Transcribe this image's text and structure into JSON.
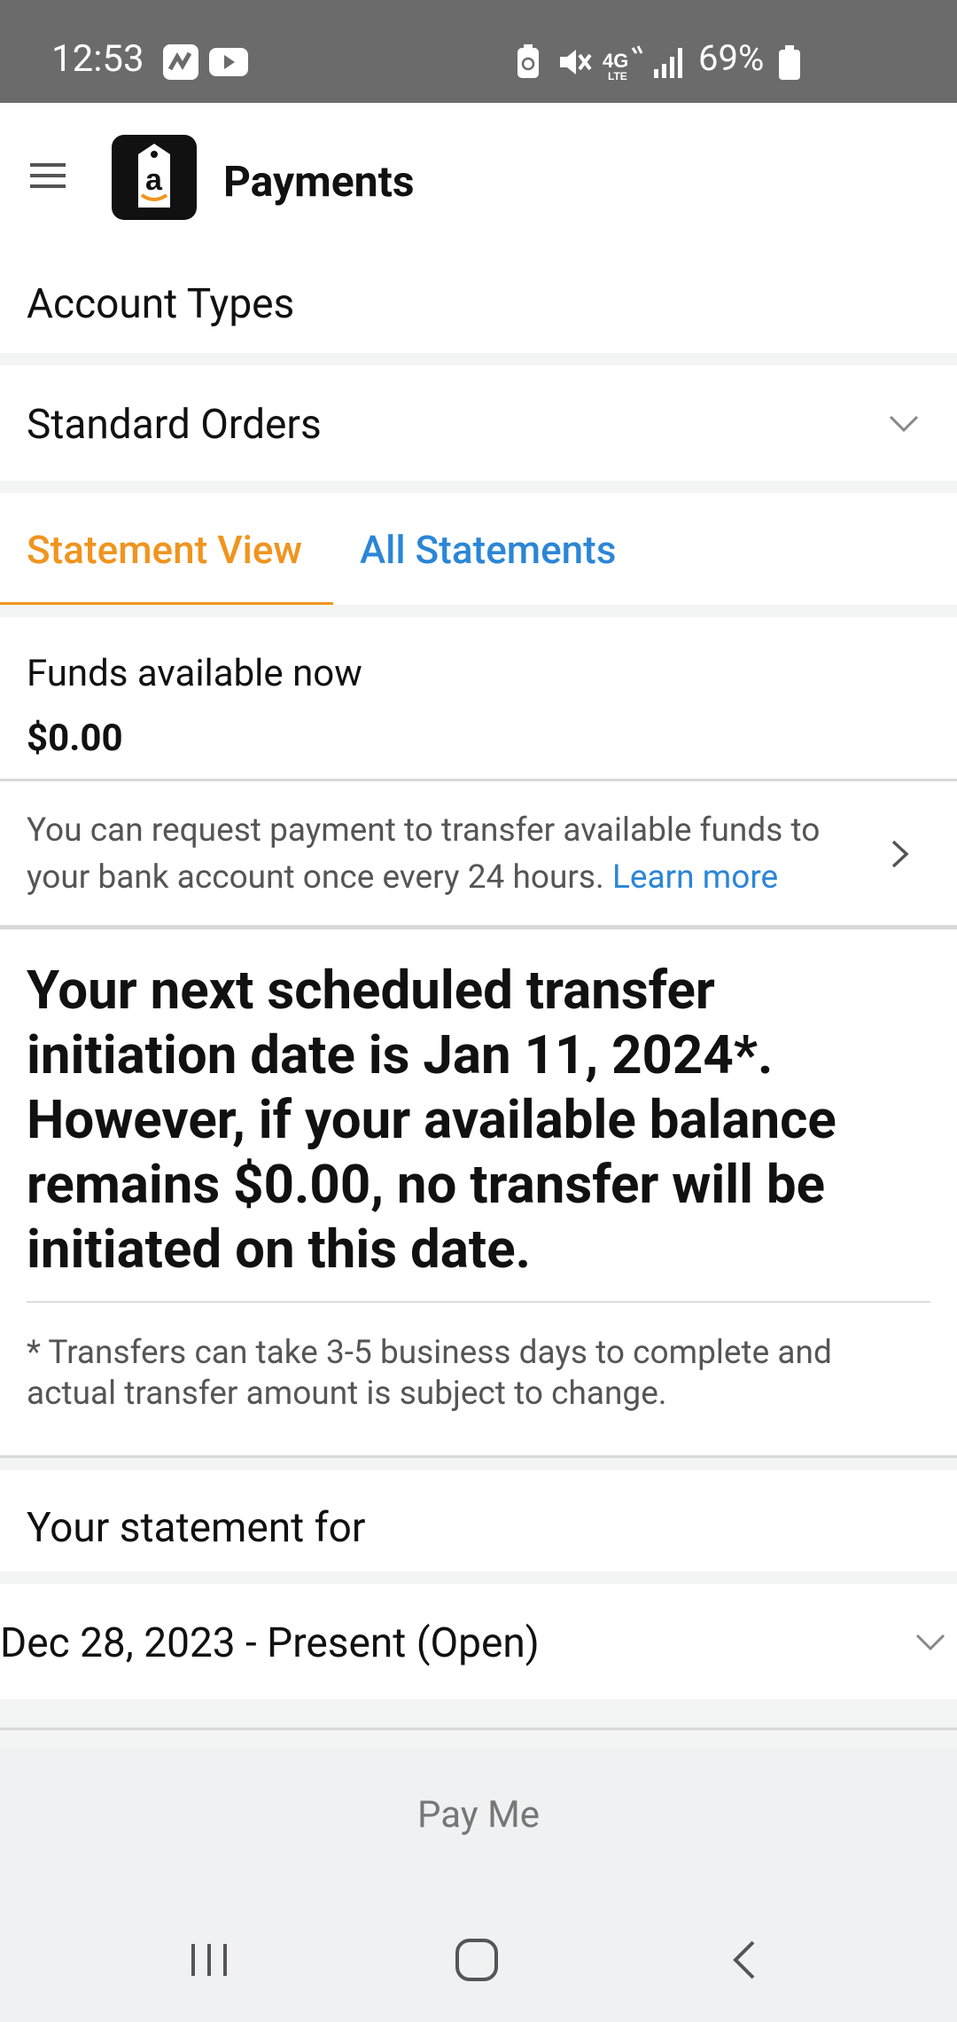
{
  "status_bar": {
    "time": "12:53",
    "battery_percent": "69%"
  },
  "app_bar": {
    "title": "Payments",
    "logo_letter": "a"
  },
  "account_types": {
    "heading": "Account Types",
    "selected": "Standard Orders"
  },
  "tabs": [
    {
      "label": "Statement View",
      "active": true
    },
    {
      "label": "All Statements",
      "active": false
    }
  ],
  "funds": {
    "label": "Funds available now",
    "value": "$0.00"
  },
  "info": {
    "text": "You can request payment to transfer available funds to your bank account once every 24 hours.",
    "link": "Learn more"
  },
  "transfer_message": "Your next scheduled transfer initiation date is Jan 11, 2024*. However, if your available balance remains $0.00, no transfer will be initiated on this date.",
  "footnote": "* Transfers can take 3-5 business days to complete and actual transfer amount is subject to change.",
  "statement": {
    "heading": "Your statement for",
    "selected_period": "Dec 28, 2023 - Present (Open)"
  },
  "pay_me_label": "Pay Me",
  "colors": {
    "accent_orange": "#f0941f",
    "link_blue": "#2b86d6"
  }
}
